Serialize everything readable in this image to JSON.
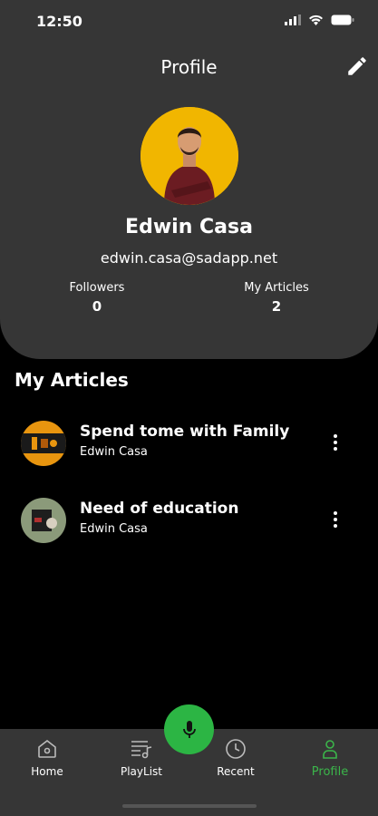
{
  "status_bar": {
    "time": "12:50"
  },
  "header": {
    "title": "Profile"
  },
  "profile": {
    "name": "Edwin Casa",
    "email": "edwin.casa@sadapp.net",
    "stats": [
      {
        "label": "Followers",
        "value": "0"
      },
      {
        "label": "My Articles",
        "value": "2"
      }
    ]
  },
  "section": {
    "title": "My Articles"
  },
  "articles": [
    {
      "title": "Spend tome with Family",
      "author": "Edwin Casa"
    },
    {
      "title": "Need of education",
      "author": "Edwin Casa"
    }
  ],
  "nav": {
    "items": [
      {
        "label": "Home",
        "icon": "home-icon"
      },
      {
        "label": "PlayList",
        "icon": "playlist-icon"
      },
      {
        "label": "Recent",
        "icon": "clock-icon"
      },
      {
        "label": "Profile",
        "icon": "person-icon"
      }
    ],
    "active": "Profile",
    "center_button_icon": "microphone-icon"
  },
  "colors": {
    "accent": "#2cb544",
    "card": "#363636",
    "avatar_bg": "#f1b600"
  }
}
